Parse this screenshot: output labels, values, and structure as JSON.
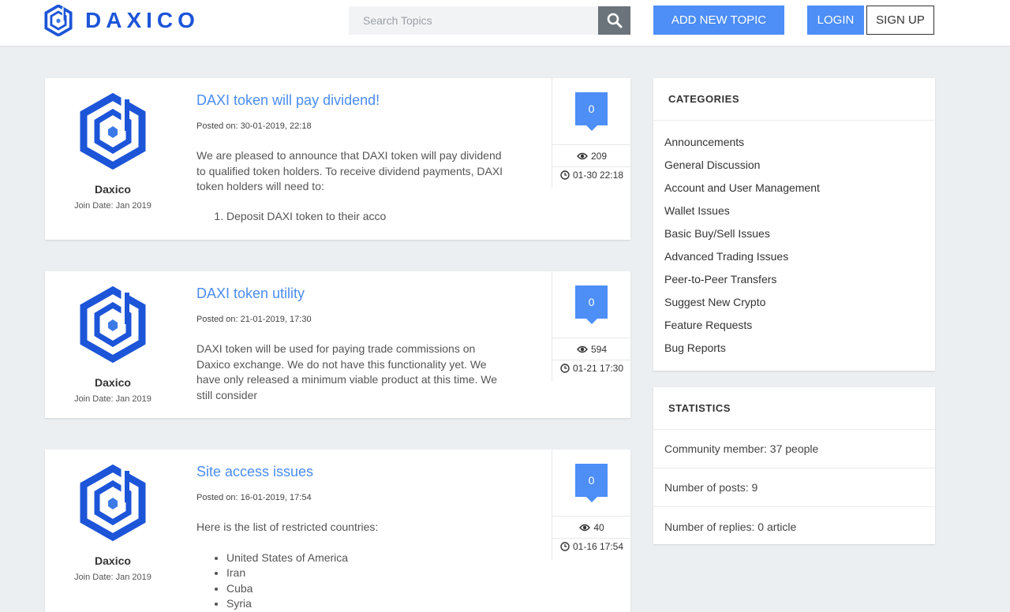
{
  "header": {
    "brand": "DAXICO",
    "search_placeholder": "Search Topics",
    "add_topic_label": "ADD NEW TOPIC",
    "login_label": "LOGIN",
    "signup_label": "SIGN UP"
  },
  "colors": {
    "brand": "#1d55d8",
    "accent": "#4d8ef7",
    "link": "#4a8df0",
    "background": "#eceff1"
  },
  "topics": [
    {
      "author": "Daxico",
      "join_date": "Join Date: Jan 2019",
      "title": "DAXI token will pay dividend!",
      "posted": "Posted on: 30-01-2019, 22:18",
      "excerpt": "We are pleased to announce that DAXI token will pay dividend to qualified token holders. To receive dividend payments, DAXI token holders will need to:",
      "list_type": "ordered",
      "list": [
        "Deposit DAXI token to their acco"
      ],
      "replies": "0",
      "views": "209",
      "date": "01-30 22:18"
    },
    {
      "author": "Daxico",
      "join_date": "Join Date: Jan 2019",
      "title": "DAXI token utility",
      "posted": "Posted on: 21-01-2019, 17:30",
      "excerpt": "DAXI token will be used for paying trade commissions on Daxico exchange. We do not have this functionality yet. We have only released a minimum viable product at this time. We still consider",
      "list_type": "none",
      "list": [],
      "replies": "0",
      "views": "594",
      "date": "01-21 17:30"
    },
    {
      "author": "Daxico",
      "join_date": "Join Date: Jan 2019",
      "title": "Site access issues",
      "posted": "Posted on: 16-01-2019, 17:54",
      "excerpt": "Here is the list of restricted countries:",
      "list_type": "bullet",
      "list": [
        "United States of America",
        "Iran",
        "Cuba",
        "Syria"
      ],
      "replies": "0",
      "views": "40",
      "date": "01-16 17:54"
    }
  ],
  "categories": {
    "title": "CATEGORIES",
    "items": [
      "Announcements",
      "General Discussion",
      "Account and User Management",
      "Wallet Issues",
      "Basic Buy/Sell Issues",
      "Advanced Trading Issues",
      "Peer-to-Peer Transfers",
      "Suggest New Crypto",
      "Feature Requests",
      "Bug Reports"
    ]
  },
  "statistics": {
    "title": "STATISTICS",
    "rows": [
      "Community member: 37 people",
      "Number of posts: 9",
      "Number of replies: 0 article"
    ]
  }
}
